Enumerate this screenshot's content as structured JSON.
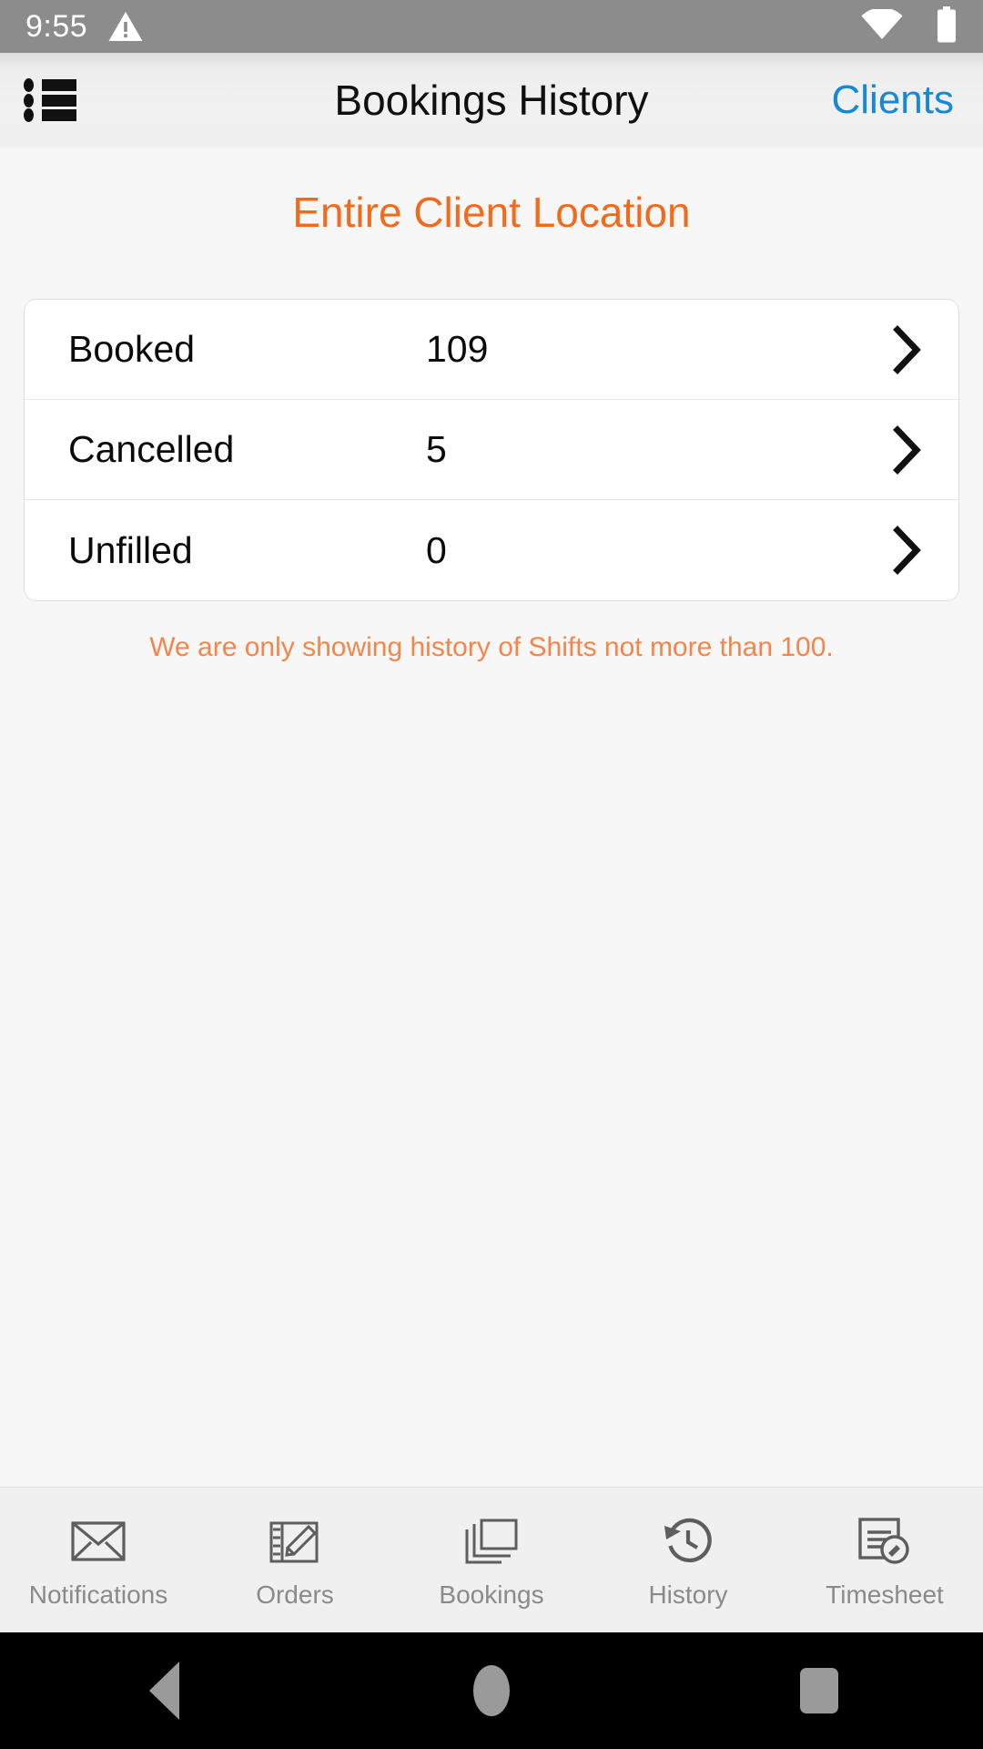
{
  "status_bar": {
    "time": "9:55",
    "warning_icon": "warning-triangle-icon",
    "wifi_icon": "wifi-icon",
    "battery_icon": "battery-icon"
  },
  "header": {
    "menu_icon": "bulleted-list-icon",
    "title": "Bookings History",
    "action_label": "Clients",
    "action_color": "#1589D8"
  },
  "main": {
    "page_title": "Entire Client Location",
    "page_title_color": "#F26B1D",
    "rows": [
      {
        "label": "Booked",
        "value": "109",
        "chevron": "chevron-right-icon"
      },
      {
        "label": "Cancelled",
        "value": "5",
        "chevron": "chevron-right-icon"
      },
      {
        "label": "Unfilled",
        "value": "0",
        "chevron": "chevron-right-icon"
      }
    ],
    "note": "We are only showing history of Shifts not more than 100.",
    "note_color": "#F4854B"
  },
  "tabbar": {
    "tabs": [
      {
        "label": "Notifications",
        "icon": "envelope-icon"
      },
      {
        "label": "Orders",
        "icon": "notepad-pencil-icon"
      },
      {
        "label": "Bookings",
        "icon": "stacked-windows-icon"
      },
      {
        "label": "History",
        "icon": "clock-rotate-left-icon"
      },
      {
        "label": "Timesheet",
        "icon": "document-pencil-badge-icon"
      }
    ],
    "label_color": "#8A8A8A"
  },
  "navbar": {
    "back": "back-triangle-icon",
    "home": "home-circle-icon",
    "recents": "recents-square-icon"
  }
}
